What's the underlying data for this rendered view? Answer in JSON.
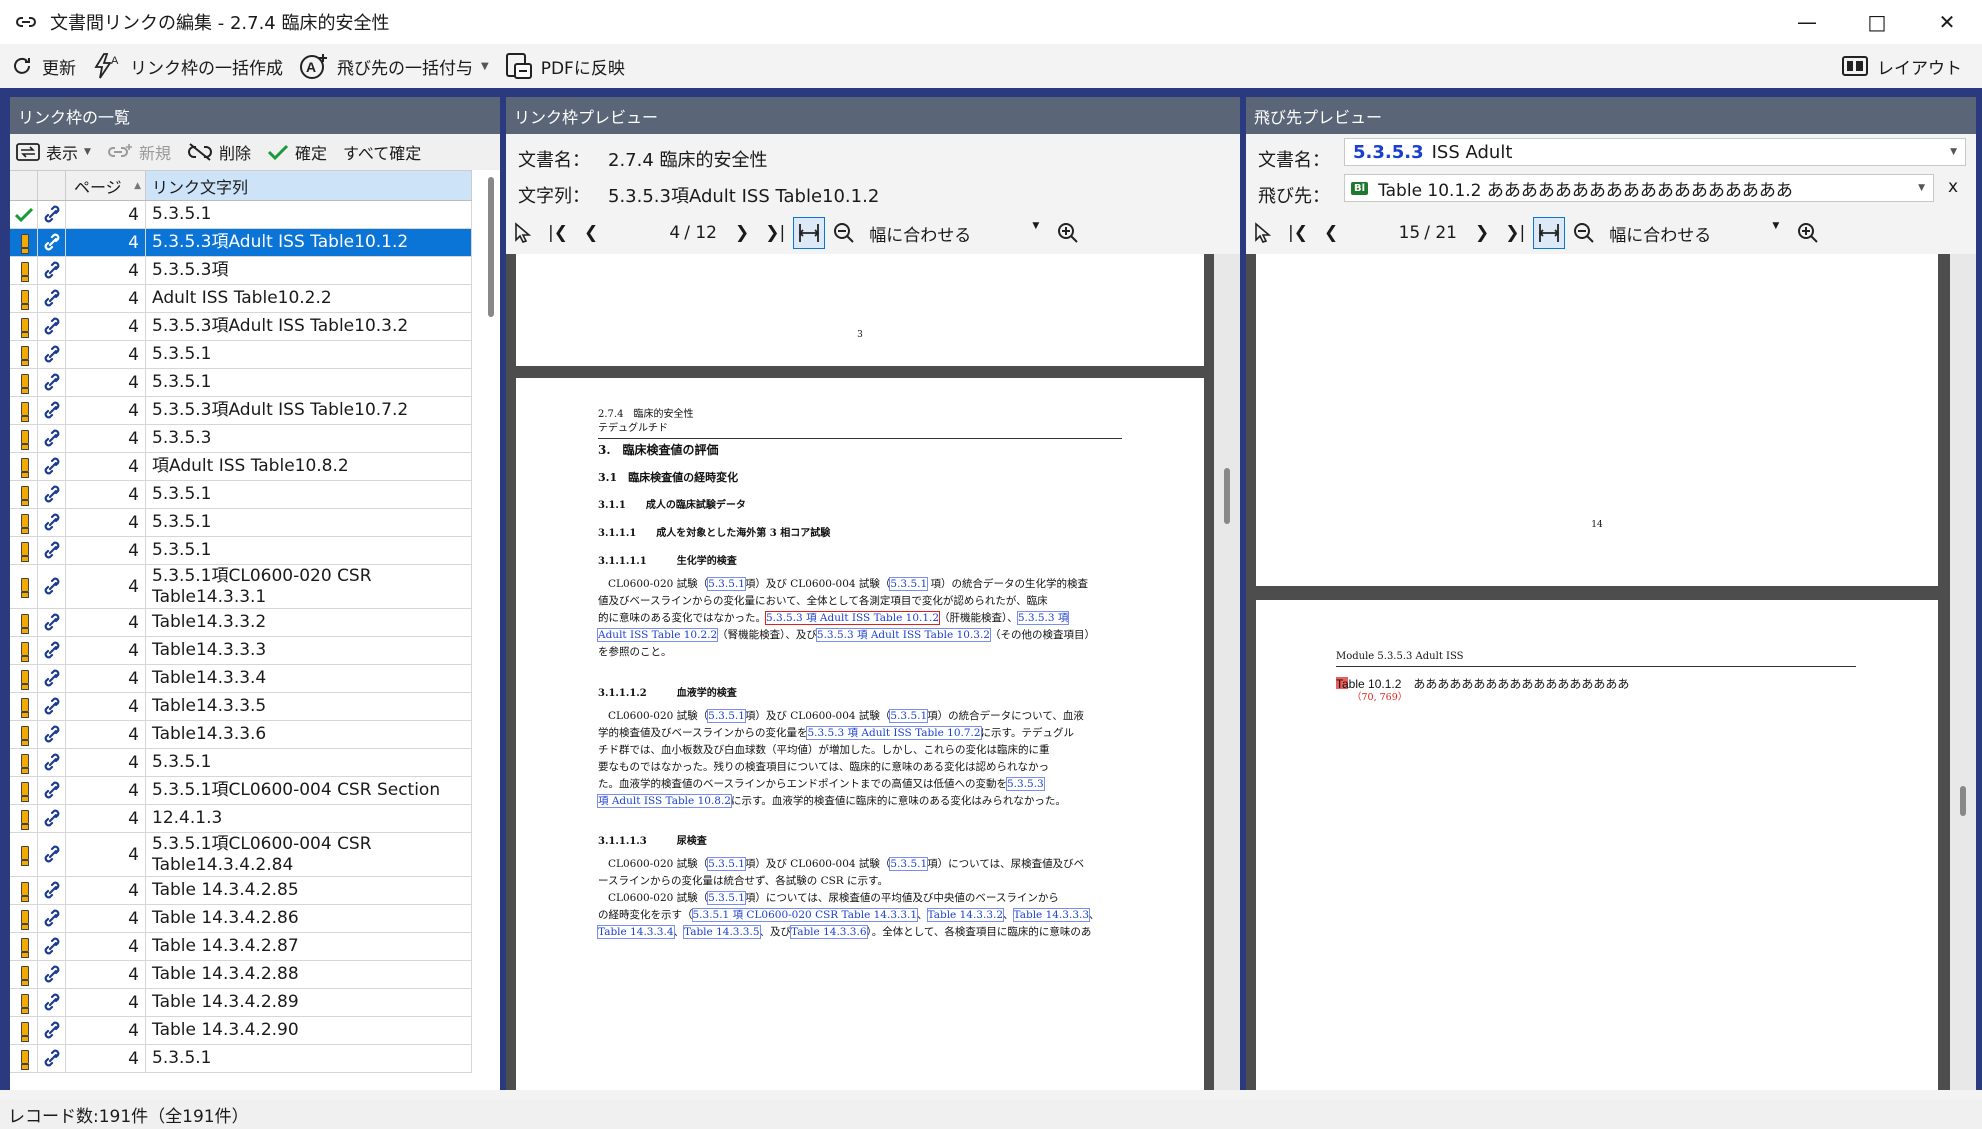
{
  "window": {
    "title": "文書間リンクの編集 - 2.7.4 臨床的安全性"
  },
  "toolbar": {
    "refresh": "更新",
    "bulk_create": "リンク枠の一括作成",
    "bulk_assign": "飛び先の一括付与",
    "apply_pdf": "PDFに反映",
    "layout": "レイアウト"
  },
  "left": {
    "title": "リンク枠の一覧",
    "tools": {
      "view": "表示",
      "new": "新規",
      "delete": "削除",
      "confirm": "確定",
      "confirm_all": "すべて確定"
    },
    "col_page": "ページ",
    "col_text": "リンク文字列",
    "rows": [
      {
        "status": "ok",
        "page": "4",
        "text": "5.3.5.1",
        "tall": false,
        "selected": false
      },
      {
        "status": "warn",
        "page": "4",
        "text": "5.3.5.3項Adult ISS Table10.1.2",
        "tall": false,
        "selected": true
      },
      {
        "status": "warn",
        "page": "4",
        "text": "5.3.5.3項",
        "tall": false,
        "selected": false
      },
      {
        "status": "warn",
        "page": "4",
        "text": "Adult ISS Table10.2.2",
        "tall": false,
        "selected": false
      },
      {
        "status": "warn",
        "page": "4",
        "text": "5.3.5.3項Adult ISS Table10.3.2",
        "tall": false,
        "selected": false
      },
      {
        "status": "warn",
        "page": "4",
        "text": "5.3.5.1",
        "tall": false,
        "selected": false
      },
      {
        "status": "warn",
        "page": "4",
        "text": "5.3.5.1",
        "tall": false,
        "selected": false
      },
      {
        "status": "warn",
        "page": "4",
        "text": "5.3.5.3項Adult ISS Table10.7.2",
        "tall": false,
        "selected": false
      },
      {
        "status": "warn",
        "page": "4",
        "text": "5.3.5.3",
        "tall": false,
        "selected": false
      },
      {
        "status": "warn",
        "page": "4",
        "text": "項Adult ISS Table10.8.2",
        "tall": false,
        "selected": false
      },
      {
        "status": "warn",
        "page": "4",
        "text": "5.3.5.1",
        "tall": false,
        "selected": false
      },
      {
        "status": "warn",
        "page": "4",
        "text": "5.3.5.1",
        "tall": false,
        "selected": false
      },
      {
        "status": "warn",
        "page": "4",
        "text": "5.3.5.1",
        "tall": false,
        "selected": false
      },
      {
        "status": "warn",
        "page": "4",
        "text": "5.3.5.1項CL0600-020 CSR Table14.3.3.1",
        "tall": true,
        "selected": false
      },
      {
        "status": "warn",
        "page": "4",
        "text": "Table14.3.3.2",
        "tall": false,
        "selected": false
      },
      {
        "status": "warn",
        "page": "4",
        "text": "Table14.3.3.3",
        "tall": false,
        "selected": false
      },
      {
        "status": "warn",
        "page": "4",
        "text": "Table14.3.3.4",
        "tall": false,
        "selected": false
      },
      {
        "status": "warn",
        "page": "4",
        "text": "Table14.3.3.5",
        "tall": false,
        "selected": false
      },
      {
        "status": "warn",
        "page": "4",
        "text": "Table14.3.3.6",
        "tall": false,
        "selected": false
      },
      {
        "status": "warn",
        "page": "4",
        "text": "5.3.5.1",
        "tall": false,
        "selected": false
      },
      {
        "status": "warn",
        "page": "4",
        "text": "5.3.5.1項CL0600-004 CSR Section",
        "tall": false,
        "selected": false
      },
      {
        "status": "warn",
        "page": "4",
        "text": "12.4.1.3",
        "tall": false,
        "selected": false
      },
      {
        "status": "warn",
        "page": "4",
        "text": "5.3.5.1項CL0600-004 CSR Table14.3.4.2.84",
        "tall": true,
        "selected": false
      },
      {
        "status": "warn",
        "page": "4",
        "text": "Table 14.3.4.2.85",
        "tall": false,
        "selected": false
      },
      {
        "status": "warn",
        "page": "4",
        "text": "Table 14.3.4.2.86",
        "tall": false,
        "selected": false
      },
      {
        "status": "warn",
        "page": "4",
        "text": "Table 14.3.4.2.87",
        "tall": false,
        "selected": false
      },
      {
        "status": "warn",
        "page": "4",
        "text": "Table 14.3.4.2.88",
        "tall": false,
        "selected": false
      },
      {
        "status": "warn",
        "page": "4",
        "text": "Table 14.3.4.2.89",
        "tall": false,
        "selected": false
      },
      {
        "status": "warn",
        "page": "4",
        "text": "Table 14.3.4.2.90",
        "tall": false,
        "selected": false
      },
      {
        "status": "warn",
        "page": "4",
        "text": "5.3.5.1",
        "tall": false,
        "selected": false
      }
    ]
  },
  "middle": {
    "title": "リンク枠プレビュー",
    "doc_label": "文書名：",
    "doc_value": "2.7.4 臨床的安全性",
    "str_label": "文字列：",
    "str_value": "5.3.5.3項Adult ISS Table10.1.2",
    "page_current": "4",
    "page_total": "/ 12",
    "zoom": "幅に合わせる",
    "doc": {
      "prev_page_num": "3",
      "hdr1": "2.7.4　臨床的安全性",
      "hdr2": "テデュグルチド",
      "h1": "3.　臨床検査値の評価",
      "h2": "3.1　臨床検査値の経時変化",
      "h3": "3.1.1　　成人の臨床試験データ",
      "h4": "3.1.1.1　　成人を対象とした海外第 3 相コア試験",
      "h5": "3.1.1.1.1　　　生化学的検査",
      "p1a": "CL0600-020 試験（",
      "p1b": "5.3.5.1",
      "p1c": "項）及び CL0600-004 試験（",
      "p1d": "5.3.5.1",
      "p1e": " 項）の統合データの生化学的検査",
      "p1l2": "値及びベースラインからの変化量において、全体として各測定項目で変化が認められたが、臨床",
      "p1l3a": "的に意味のある変化ではなかった。",
      "p1l3b": "5.3.5.3 項 Adult ISS Table 10.1.2",
      "p1l3c": "（肝機能検査）、",
      "p1l3d": "5.3.5.3 項",
      "p1l4a": "Adult ISS Table 10.2.2",
      "p1l4b": "（腎機能検査）、及び",
      "p1l4c": "5.3.5.3 項 Adult ISS Table 10.3.2",
      "p1l4d": "（その他の検査項目）",
      "p1l5": "を参照のこと。",
      "h6": "3.1.1.1.2　　　血液学的検査",
      "p2a": "CL0600-020 試験（",
      "p2b": "5.3.5.1",
      "p2c": "項）及び CL0600-004 試験（",
      "p2d": "5.3.5.1",
      "p2e": "項）の統合データについて、血液",
      "p2l2a": "学的検査値及びベースラインからの変化量を",
      "p2l2b": "5.3.5.3 項 Adult ISS Table 10.7.2",
      "p2l2c": "に示す。テデュグル",
      "p2l3": "チド群では、血小板数及び白血球数（平均値）が増加した。しかし、これらの変化は臨床的に重",
      "p2l4": "要なものではなかった。残りの検査項目については、臨床的に意味のある変化は認められなかっ",
      "p2l5a": "た。血液学的検査値のベースラインからエンドポイントまでの高値又は低値への変動を",
      "p2l5b": "5.3.5.3",
      "p2l6a": "項 Adult ISS Table 10.8.2",
      "p2l6b": "に示す。血液学的検査値に臨床的に意味のある変化はみられなかった。",
      "h7": "3.1.1.1.3　　　尿検査",
      "p3a": "CL0600-020 試験（",
      "p3b": "5.3.5.1",
      "p3c": "項）及び CL0600-004 試験（",
      "p3d": "5.3.5.1",
      "p3e": "項）については、尿検査値及びベ",
      "p3l2": "ースラインからの変化量は統合せず、各試験の CSR に示す。",
      "p4a": "CL0600-020 試験（",
      "p4b": "5.3.5.1",
      "p4c": "項）については、尿検査値の平均値及び中央値のベースラインから",
      "p4l2a": "の経時変化を示す（",
      "p4l2b": "5.3.5.1 項 CL0600-020 CSR Table 14.3.3.1",
      "p4l2c": "、",
      "p4l2d": "Table 14.3.3.2",
      "p4l2e": "、",
      "p4l2f": "Table 14.3.3.3",
      "p4l2g": "、",
      "p4l3a": "Table 14.3.3.4",
      "p4l3b": "、",
      "p4l3c": "Table 14.3.3.5",
      "p4l3d": "、及び",
      "p4l3e": "Table 14.3.3.6",
      "p4l3f": "）。全体として、各検査項目に臨床的に意味のあ"
    }
  },
  "right": {
    "title": "飛び先プレビュー",
    "doc_label": "文書名：",
    "doc_code": "5.3.5.3",
    "doc_name": "ISS Adult",
    "dest_label": "飛び先：",
    "dest_badge": "Bl",
    "dest_value": "Table 10.1.2 ああああああああああああああああああ",
    "dest_clear": "x",
    "page_current": "15",
    "page_total": "/ 21",
    "zoom": "幅に合わせる",
    "doc": {
      "prev_page_num": "14",
      "module_hdr": "Module 5.3.5.3 Adult ISS",
      "table_title": "Table 10.1.2　ああああああああああああああああああ",
      "coord": "（70, 769）"
    }
  },
  "status": {
    "records": "レコード数:191件（全191件）"
  },
  "colors": {
    "accent": "#0a74d7",
    "frame": "#2b3a7e",
    "panel_header": "#5a6577",
    "warn": "#f2a900",
    "ok": "#1a9a3a",
    "link": "#1a3fd0"
  }
}
